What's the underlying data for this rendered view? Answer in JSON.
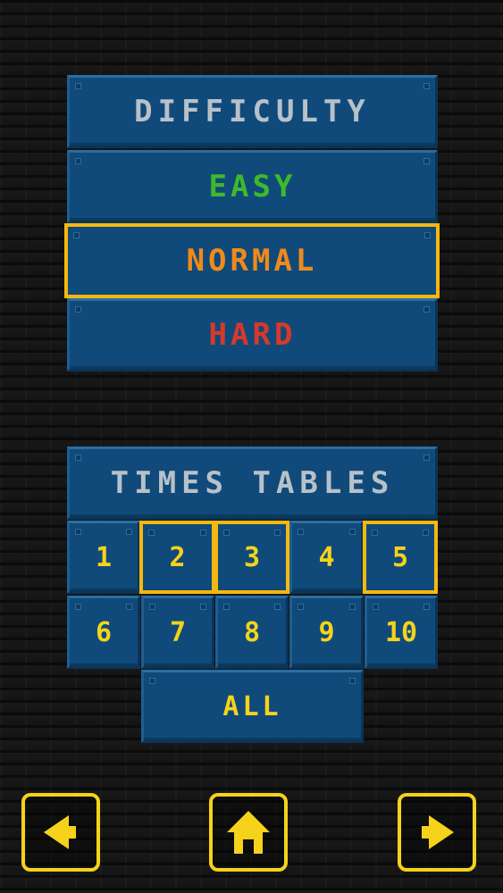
{
  "difficulty": {
    "title": "DIFFICULTY",
    "options": [
      "EASY",
      "NORMAL",
      "HARD"
    ],
    "selected": "NORMAL"
  },
  "tables": {
    "title": "TIMES TABLES",
    "numbers": [
      "1",
      "2",
      "3",
      "4",
      "5",
      "6",
      "7",
      "8",
      "9",
      "10"
    ],
    "selected": [
      "2",
      "3",
      "5"
    ],
    "all_label": "ALL"
  },
  "nav": {
    "back_icon": "left-arrow-icon",
    "home_icon": "home-icon",
    "forward_icon": "right-arrow-icon"
  },
  "colors": {
    "panel": "#0f4a7a",
    "highlight": "#f5b80f",
    "easy": "#3fb82b",
    "normal": "#f08a1b",
    "hard": "#d6392a",
    "number": "#f5d21b",
    "header": "#b8c1c8"
  }
}
